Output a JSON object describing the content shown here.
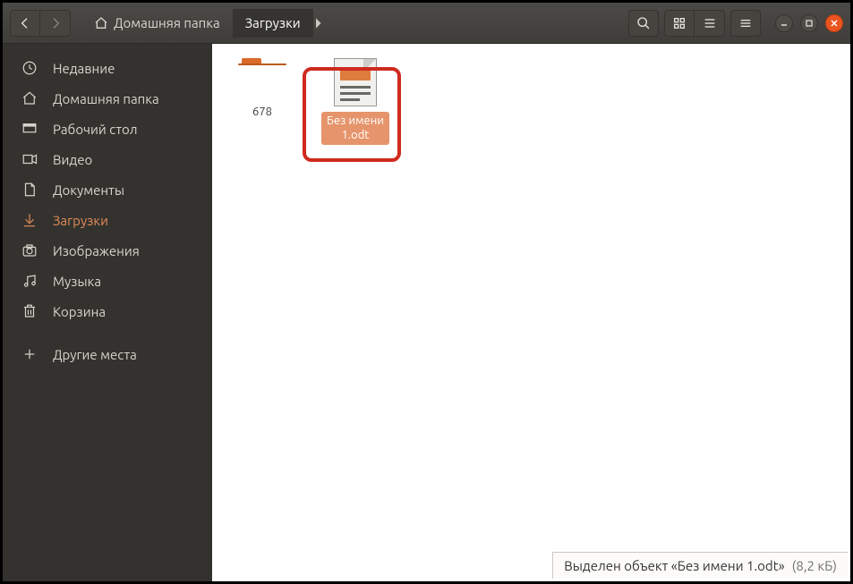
{
  "breadcrumb": {
    "home": "Домашняя папка",
    "current": "Загрузки"
  },
  "sidebar": {
    "items": [
      {
        "id": "recent",
        "label": "Недавние",
        "icon": "clock"
      },
      {
        "id": "home",
        "label": "Домашняя папка",
        "icon": "home"
      },
      {
        "id": "desktop",
        "label": "Рабочий стол",
        "icon": "desktop"
      },
      {
        "id": "videos",
        "label": "Видео",
        "icon": "video"
      },
      {
        "id": "documents",
        "label": "Документы",
        "icon": "doc"
      },
      {
        "id": "downloads",
        "label": "Загрузки",
        "icon": "download",
        "active": true
      },
      {
        "id": "pictures",
        "label": "Изображения",
        "icon": "camera"
      },
      {
        "id": "music",
        "label": "Музыка",
        "icon": "music"
      },
      {
        "id": "trash",
        "label": "Корзина",
        "icon": "trash"
      }
    ],
    "other": {
      "label": "Другие места",
      "icon": "plus"
    }
  },
  "files": [
    {
      "type": "folder",
      "name": "678"
    },
    {
      "type": "document",
      "name": "Без имени 1.odt",
      "selected": true
    }
  ],
  "status": {
    "text": "Выделен объект «Без имени 1.odt»",
    "size": "(8,2 кБ)"
  }
}
